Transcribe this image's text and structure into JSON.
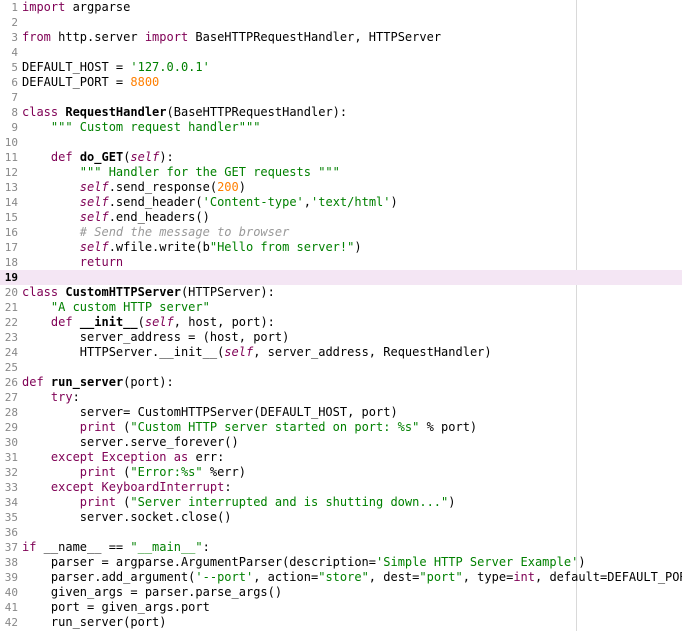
{
  "lines": [
    {
      "num": "1",
      "tokens": [
        {
          "t": "import",
          "c": "k"
        },
        {
          "t": " argparse",
          "c": ""
        }
      ]
    },
    {
      "num": "2",
      "tokens": []
    },
    {
      "num": "3",
      "tokens": [
        {
          "t": "from",
          "c": "k"
        },
        {
          "t": " http.server ",
          "c": ""
        },
        {
          "t": "import",
          "c": "k"
        },
        {
          "t": " BaseHTTPRequestHandler, HTTPServer",
          "c": ""
        }
      ]
    },
    {
      "num": "4",
      "tokens": []
    },
    {
      "num": "5",
      "tokens": [
        {
          "t": "DEFAULT_HOST = ",
          "c": ""
        },
        {
          "t": "'127.0.0.1'",
          "c": "s"
        }
      ]
    },
    {
      "num": "6",
      "tokens": [
        {
          "t": "DEFAULT_PORT = ",
          "c": ""
        },
        {
          "t": "8800",
          "c": "n"
        }
      ]
    },
    {
      "num": "7",
      "tokens": []
    },
    {
      "num": "8",
      "tokens": [
        {
          "t": "class",
          "c": "k"
        },
        {
          "t": " ",
          "c": ""
        },
        {
          "t": "RequestHandler",
          "c": "f"
        },
        {
          "t": "(BaseHTTPRequestHandler):",
          "c": ""
        }
      ]
    },
    {
      "num": "9",
      "tokens": [
        {
          "t": "    ",
          "c": ""
        },
        {
          "t": "\"\"\" Custom request handler\"\"\"",
          "c": "s"
        }
      ]
    },
    {
      "num": "10",
      "tokens": []
    },
    {
      "num": "11",
      "tokens": [
        {
          "t": "    ",
          "c": ""
        },
        {
          "t": "def",
          "c": "k"
        },
        {
          "t": " ",
          "c": ""
        },
        {
          "t": "do_GET",
          "c": "f"
        },
        {
          "t": "(",
          "c": ""
        },
        {
          "t": "self",
          "c": "sf"
        },
        {
          "t": "):",
          "c": ""
        }
      ]
    },
    {
      "num": "12",
      "tokens": [
        {
          "t": "        ",
          "c": ""
        },
        {
          "t": "\"\"\" Handler for the GET requests \"\"\"",
          "c": "s"
        }
      ]
    },
    {
      "num": "13",
      "tokens": [
        {
          "t": "        ",
          "c": ""
        },
        {
          "t": "self",
          "c": "sf"
        },
        {
          "t": ".send_response(",
          "c": ""
        },
        {
          "t": "200",
          "c": "n"
        },
        {
          "t": ")",
          "c": ""
        }
      ]
    },
    {
      "num": "14",
      "tokens": [
        {
          "t": "        ",
          "c": ""
        },
        {
          "t": "self",
          "c": "sf"
        },
        {
          "t": ".send_header(",
          "c": ""
        },
        {
          "t": "'Content-type'",
          "c": "s"
        },
        {
          "t": ",",
          "c": ""
        },
        {
          "t": "'text/html'",
          "c": "s"
        },
        {
          "t": ")",
          "c": ""
        }
      ]
    },
    {
      "num": "15",
      "tokens": [
        {
          "t": "        ",
          "c": ""
        },
        {
          "t": "self",
          "c": "sf"
        },
        {
          "t": ".end_headers()",
          "c": ""
        }
      ]
    },
    {
      "num": "16",
      "tokens": [
        {
          "t": "        ",
          "c": ""
        },
        {
          "t": "# Send the message to browser",
          "c": "c"
        }
      ]
    },
    {
      "num": "17",
      "tokens": [
        {
          "t": "        ",
          "c": ""
        },
        {
          "t": "self",
          "c": "sf"
        },
        {
          "t": ".wfile.write(b",
          "c": ""
        },
        {
          "t": "\"Hello from server!\"",
          "c": "s"
        },
        {
          "t": ")",
          "c": ""
        }
      ]
    },
    {
      "num": "18",
      "tokens": [
        {
          "t": "        ",
          "c": ""
        },
        {
          "t": "return",
          "c": "k"
        }
      ]
    },
    {
      "num": "19",
      "tokens": [],
      "current": true
    },
    {
      "num": "20",
      "tokens": [
        {
          "t": "class",
          "c": "k"
        },
        {
          "t": " ",
          "c": ""
        },
        {
          "t": "CustomHTTPServer",
          "c": "f"
        },
        {
          "t": "(HTTPServer):",
          "c": ""
        }
      ]
    },
    {
      "num": "21",
      "tokens": [
        {
          "t": "    ",
          "c": ""
        },
        {
          "t": "\"A custom HTTP server\"",
          "c": "s"
        }
      ]
    },
    {
      "num": "22",
      "tokens": [
        {
          "t": "    ",
          "c": ""
        },
        {
          "t": "def",
          "c": "k"
        },
        {
          "t": " ",
          "c": ""
        },
        {
          "t": "__init__",
          "c": "f"
        },
        {
          "t": "(",
          "c": ""
        },
        {
          "t": "self",
          "c": "sf"
        },
        {
          "t": ", host, port):",
          "c": ""
        }
      ]
    },
    {
      "num": "23",
      "tokens": [
        {
          "t": "        server_address = (host, port)",
          "c": ""
        }
      ]
    },
    {
      "num": "24",
      "tokens": [
        {
          "t": "        HTTPServer.__init__(",
          "c": ""
        },
        {
          "t": "self",
          "c": "sf"
        },
        {
          "t": ", server_address, RequestHandler)",
          "c": ""
        }
      ]
    },
    {
      "num": "25",
      "tokens": []
    },
    {
      "num": "26",
      "tokens": [
        {
          "t": "def",
          "c": "k"
        },
        {
          "t": " ",
          "c": ""
        },
        {
          "t": "run_server",
          "c": "f"
        },
        {
          "t": "(port):",
          "c": ""
        }
      ]
    },
    {
      "num": "27",
      "tokens": [
        {
          "t": "    ",
          "c": ""
        },
        {
          "t": "try",
          "c": "k"
        },
        {
          "t": ":",
          "c": ""
        }
      ]
    },
    {
      "num": "28",
      "tokens": [
        {
          "t": "        server= CustomHTTPServer(DEFAULT_HOST, port)",
          "c": ""
        }
      ]
    },
    {
      "num": "29",
      "tokens": [
        {
          "t": "        ",
          "c": ""
        },
        {
          "t": "print",
          "c": "k"
        },
        {
          "t": " (",
          "c": ""
        },
        {
          "t": "\"Custom HTTP server started on port: %s\"",
          "c": "s"
        },
        {
          "t": " % port)",
          "c": ""
        }
      ]
    },
    {
      "num": "30",
      "tokens": [
        {
          "t": "        server.serve_forever()",
          "c": ""
        }
      ]
    },
    {
      "num": "31",
      "tokens": [
        {
          "t": "    ",
          "c": ""
        },
        {
          "t": "except",
          "c": "k"
        },
        {
          "t": " ",
          "c": ""
        },
        {
          "t": "Exception",
          "c": "k"
        },
        {
          "t": " ",
          "c": ""
        },
        {
          "t": "as",
          "c": "k"
        },
        {
          "t": " err:",
          "c": ""
        }
      ]
    },
    {
      "num": "32",
      "tokens": [
        {
          "t": "        ",
          "c": ""
        },
        {
          "t": "print",
          "c": "k"
        },
        {
          "t": " (",
          "c": ""
        },
        {
          "t": "\"Error:%s\"",
          "c": "s"
        },
        {
          "t": " %err)",
          "c": ""
        }
      ]
    },
    {
      "num": "33",
      "tokens": [
        {
          "t": "    ",
          "c": ""
        },
        {
          "t": "except",
          "c": "k"
        },
        {
          "t": " ",
          "c": ""
        },
        {
          "t": "KeyboardInterrupt",
          "c": "k"
        },
        {
          "t": ":",
          "c": ""
        }
      ]
    },
    {
      "num": "34",
      "tokens": [
        {
          "t": "        ",
          "c": ""
        },
        {
          "t": "print",
          "c": "k"
        },
        {
          "t": " (",
          "c": ""
        },
        {
          "t": "\"Server interrupted and is shutting down...\"",
          "c": "s"
        },
        {
          "t": ")",
          "c": ""
        }
      ]
    },
    {
      "num": "35",
      "tokens": [
        {
          "t": "        server.socket.close()",
          "c": ""
        }
      ]
    },
    {
      "num": "36",
      "tokens": []
    },
    {
      "num": "37",
      "tokens": [
        {
          "t": "if",
          "c": "k"
        },
        {
          "t": " __name__ == ",
          "c": ""
        },
        {
          "t": "\"__main__\"",
          "c": "s"
        },
        {
          "t": ":",
          "c": ""
        }
      ]
    },
    {
      "num": "38",
      "tokens": [
        {
          "t": "    parser = argparse.ArgumentParser(description=",
          "c": ""
        },
        {
          "t": "'Simple HTTP Server Example'",
          "c": "s"
        },
        {
          "t": ")",
          "c": ""
        }
      ]
    },
    {
      "num": "39",
      "tokens": [
        {
          "t": "    parser.add_argument(",
          "c": ""
        },
        {
          "t": "'--port'",
          "c": "s"
        },
        {
          "t": ", action=",
          "c": ""
        },
        {
          "t": "\"store\"",
          "c": "s"
        },
        {
          "t": ", dest=",
          "c": ""
        },
        {
          "t": "\"port\"",
          "c": "s"
        },
        {
          "t": ", type=",
          "c": ""
        },
        {
          "t": "int",
          "c": "k"
        },
        {
          "t": ", default=DEFAULT_PORT)",
          "c": ""
        }
      ]
    },
    {
      "num": "40",
      "tokens": [
        {
          "t": "    given_args = parser.parse_args()",
          "c": ""
        }
      ]
    },
    {
      "num": "41",
      "tokens": [
        {
          "t": "    port = given_args.port",
          "c": ""
        }
      ]
    },
    {
      "num": "42",
      "tokens": [
        {
          "t": "    run_server(port)",
          "c": ""
        }
      ]
    }
  ]
}
